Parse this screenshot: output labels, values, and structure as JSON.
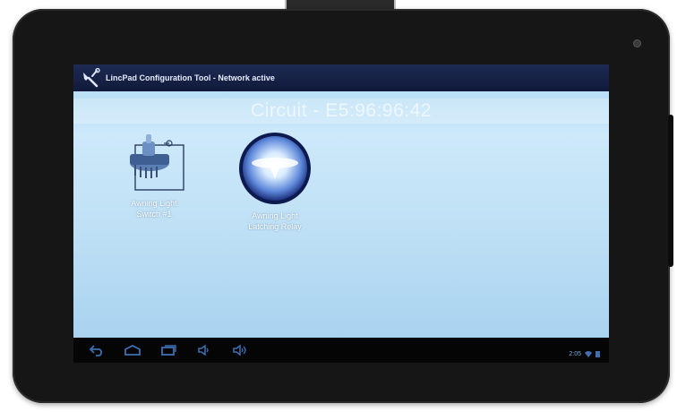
{
  "app": {
    "title": "LincPad Configuration Tool - Network active"
  },
  "circuit": {
    "title": "Circuit - E5:96:96:42"
  },
  "devices": [
    {
      "label_line1": "Awning Light",
      "label_line2": "Switch #1",
      "icon": "switch-icon"
    },
    {
      "label_line1": "Awning Light",
      "label_line2": "Latching Relay",
      "icon": "relay-icon"
    }
  ],
  "navbar": {
    "buttons": [
      "back-icon",
      "home-icon",
      "recent-apps-icon",
      "volume-down-icon",
      "volume-up-icon"
    ],
    "clock": "2:05"
  },
  "colors": {
    "title_bar": "#1d2a52",
    "content_bg": "#bfe0f5",
    "nav_bg": "#050505",
    "nav_icon": "#3f6fb2"
  }
}
